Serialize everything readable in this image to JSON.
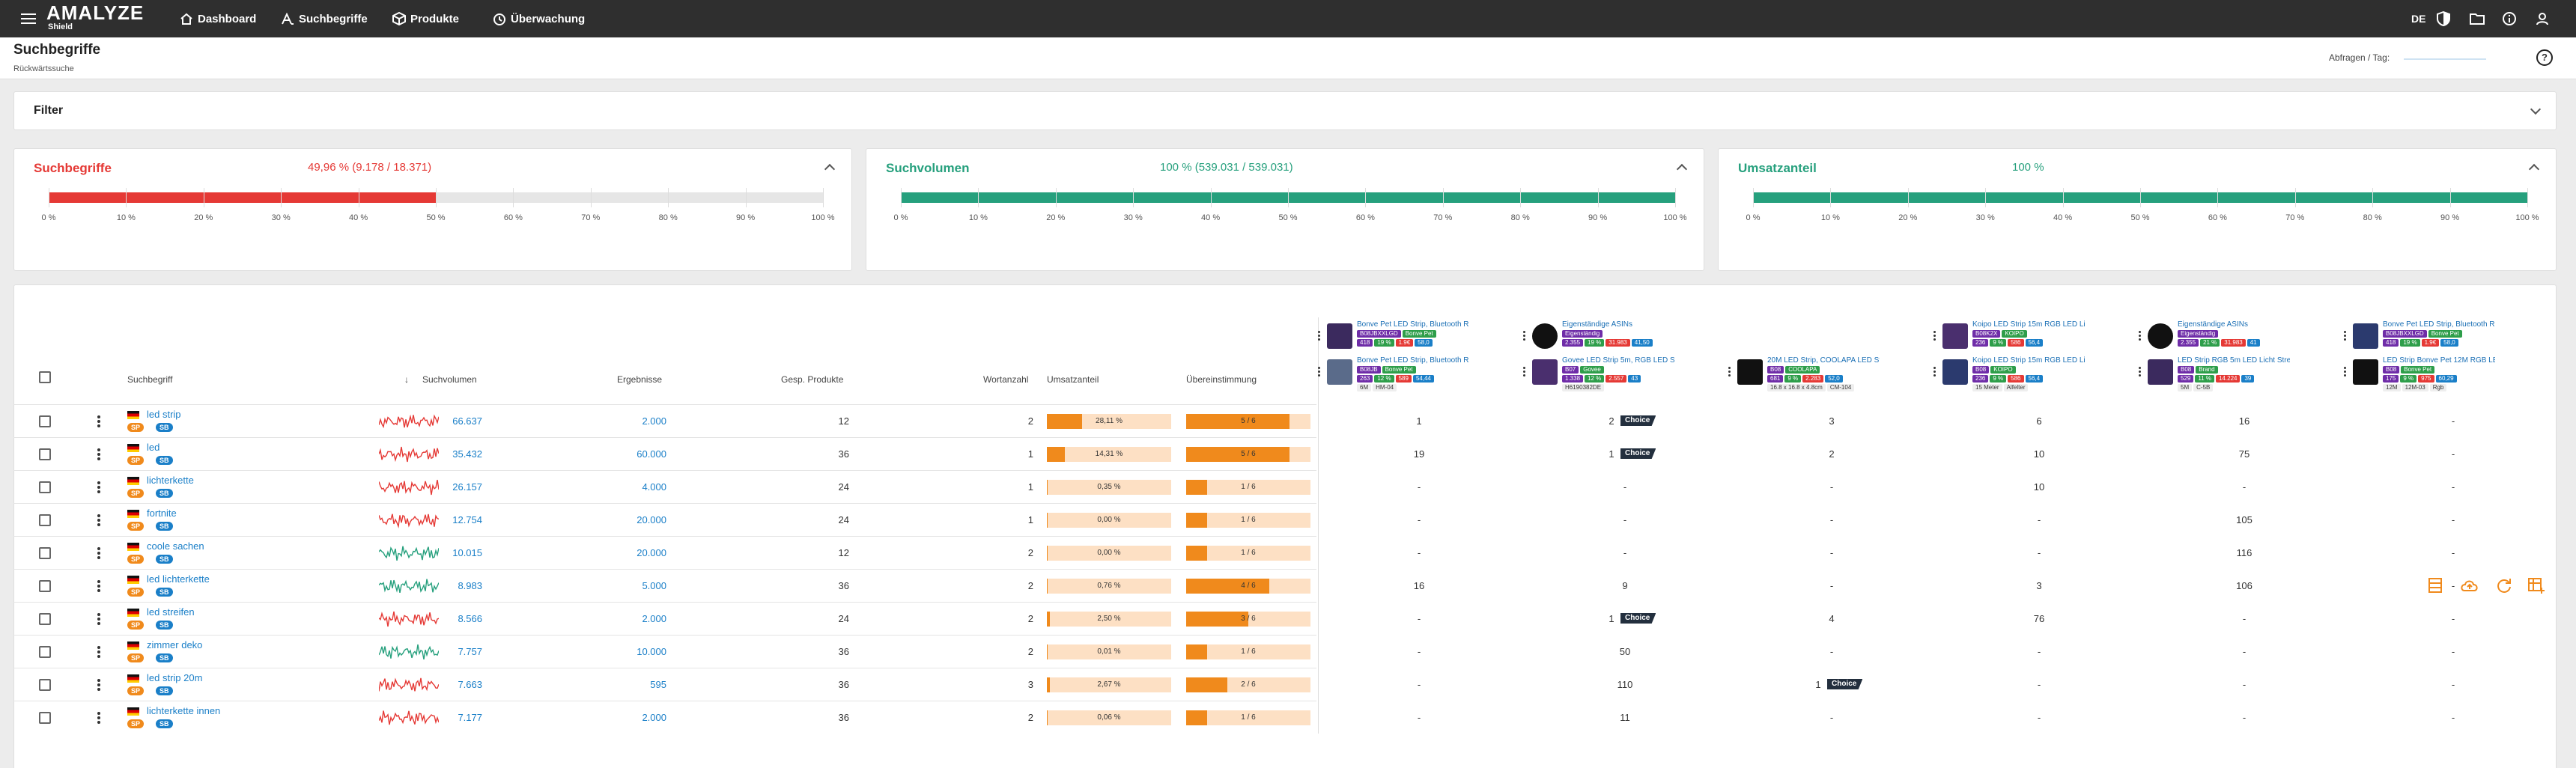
{
  "app": {
    "logo": "AMALYZE",
    "logo_sub": "Shield"
  },
  "nav": {
    "items": [
      "Dashboard",
      "Suchbegriffe",
      "Produkte",
      "Überwachung"
    ],
    "lang": "DE"
  },
  "page": {
    "title": "Suchbegriffe",
    "subtitle": "Rückwärtssuche",
    "quota_label": "Abfragen / Tag:"
  },
  "filter": {
    "label": "Filter"
  },
  "kpis": [
    {
      "title": "Suchbegriffe",
      "value": "49,96 % (9.178 / 18.371)",
      "fill": 0.4996,
      "color": "#e53935"
    },
    {
      "title": "Suchvolumen",
      "value": "100 % (539.031 / 539.031)",
      "fill": 1.0,
      "color": "#26a07d"
    },
    {
      "title": "Umsatzanteil",
      "value": "100 %",
      "fill": 1.0,
      "color": "#26a07d"
    }
  ],
  "kpi_ticks": [
    "0 %",
    "10 %",
    "20 %",
    "30 %",
    "40 %",
    "50 %",
    "60 %",
    "70 %",
    "80 %",
    "90 %",
    "100 %"
  ],
  "columns": {
    "keyword": "Suchbegriff",
    "volume": "Suchvolumen",
    "results": "Ergebnisse",
    "products": "Gesp. Produkte",
    "words": "Wortanzahl",
    "share": "Umsatzanteil",
    "match": "Übereinstimmung"
  },
  "products_top": [
    {
      "title": "Bonve Pet LED Strip, Bluetooth RGB L",
      "pills": [
        "B08JBXXLGD",
        "Bonve Pet"
      ],
      "pills2": [
        "418",
        "19 %",
        "1.9€",
        "58,0"
      ]
    },
    {
      "title": "Eigenständige ASINs",
      "pills": [
        "Eigenständig"
      ],
      "pills2": [
        "2.355",
        "19 %",
        "31.983",
        "41,50"
      ]
    },
    {
      "title": "",
      "pills": [],
      "pills2": []
    },
    {
      "title": "Koipo LED Strip 15m RGB LED Lichte",
      "pills": [
        "B08K2X",
        "KOIPO"
      ],
      "pills2": [
        "236",
        "9 %",
        "586",
        "56,4"
      ]
    },
    {
      "title": "Eigenständige ASINs",
      "pills": [
        "Eigenständig"
      ],
      "pills2": [
        "2.355",
        "21 %",
        "31.983",
        "41"
      ]
    },
    {
      "title": "Bonve Pet LED Strip, Bluetooth RGB L",
      "pills": [
        "B08JBXXLGD",
        "Bonve Pet"
      ],
      "pills2": [
        "418",
        "19 %",
        "1.9€",
        "58,0"
      ]
    }
  ],
  "products_bottom": [
    {
      "title": "Bonve Pet LED Strip, Bluetooth RGB L",
      "pills": [
        "B08JB",
        "Bonve Pet"
      ],
      "pills2": [
        "263",
        "12 %",
        "589",
        "54,44"
      ],
      "tags": [
        "6M",
        "HM-04"
      ]
    },
    {
      "title": "Govee LED Strip 5m, RGB LED Streife",
      "pills": [
        "B07",
        "Govee"
      ],
      "pills2": [
        "1.338",
        "12 %",
        "2.557",
        "43"
      ],
      "tags": [
        "H6190382DE"
      ]
    },
    {
      "title": "20M LED Strip, COOLAPA LED Streife",
      "pills": [
        "B08",
        "COOLAPA"
      ],
      "pills2": [
        "681",
        "9 %",
        "2.283",
        "52,0"
      ],
      "tags": [
        "16.8 x 16.8 x 4.8cm",
        "CM-104"
      ]
    },
    {
      "title": "Koipo LED Strip 15m RGB LED Lichte",
      "pills": [
        "B08",
        "KOIPO"
      ],
      "pills2": [
        "236",
        "9 %",
        "586",
        "56,4"
      ],
      "tags": [
        "15 Meter",
        "Alfelter"
      ]
    },
    {
      "title": "LED Strip RGB 5m LED Licht Streifen",
      "pills": [
        "B08",
        "Brand"
      ],
      "pills2": [
        "529",
        "11 %",
        "14.224",
        "39"
      ],
      "tags": [
        "5M",
        "C-5B"
      ]
    },
    {
      "title": "LED Strip Bonve Pet 12M RGB LED Str",
      "pills": [
        "B08",
        "Bonve Pet"
      ],
      "pills2": [
        "175",
        "9 %",
        "975",
        "60,29"
      ],
      "tags": [
        "12M",
        "12M-03",
        "Rgb"
      ]
    }
  ],
  "rows": [
    {
      "kw": "led strip",
      "vol": "66.637",
      "res": "2.000",
      "prod": "12",
      "words": "2",
      "share": "28,11 %",
      "share_v": 0.2811,
      "match": "5 / 6",
      "match_v": 0.833,
      "color": "#e53935",
      "ranks": [
        "1",
        "2",
        "3",
        "6",
        "16",
        "-"
      ],
      "choice": 1
    },
    {
      "kw": "led",
      "vol": "35.432",
      "res": "60.000",
      "prod": "36",
      "words": "1",
      "share": "14,31 %",
      "share_v": 0.1431,
      "match": "5 / 6",
      "match_v": 0.833,
      "color": "#e53935",
      "ranks": [
        "19",
        "1",
        "2",
        "10",
        "75",
        "-"
      ],
      "choice": 1
    },
    {
      "kw": "lichterkette",
      "vol": "26.157",
      "res": "4.000",
      "prod": "24",
      "words": "1",
      "share": "0,35 %",
      "share_v": 0.0035,
      "match": "1 / 6",
      "match_v": 0.167,
      "color": "#e53935",
      "ranks": [
        "-",
        "-",
        "-",
        "10",
        "-",
        "-"
      ],
      "choice": -1
    },
    {
      "kw": "fortnite",
      "vol": "12.754",
      "res": "20.000",
      "prod": "24",
      "words": "1",
      "share": "0,00 %",
      "share_v": 0.0,
      "match": "1 / 6",
      "match_v": 0.167,
      "color": "#e53935",
      "ranks": [
        "-",
        "-",
        "-",
        "-",
        "105",
        "-"
      ],
      "choice": -1
    },
    {
      "kw": "coole sachen",
      "vol": "10.015",
      "res": "20.000",
      "prod": "12",
      "words": "2",
      "share": "0,00 %",
      "share_v": 0.0,
      "match": "1 / 6",
      "match_v": 0.167,
      "color": "#26a07d",
      "ranks": [
        "-",
        "-",
        "-",
        "-",
        "116",
        "-"
      ],
      "choice": -1
    },
    {
      "kw": "led lichterkette",
      "vol": "8.983",
      "res": "5.000",
      "prod": "36",
      "words": "2",
      "share": "0,76 %",
      "share_v": 0.0076,
      "match": "4 / 6",
      "match_v": 0.667,
      "color": "#26a07d",
      "ranks": [
        "16",
        "9",
        "-",
        "3",
        "106",
        "-"
      ],
      "choice": -1
    },
    {
      "kw": "led streifen",
      "vol": "8.566",
      "res": "2.000",
      "prod": "24",
      "words": "2",
      "share": "2,50 %",
      "share_v": 0.025,
      "match": "3 / 6",
      "match_v": 0.5,
      "color": "#e53935",
      "ranks": [
        "-",
        "1",
        "4",
        "76",
        "-",
        "-"
      ],
      "choice": 1
    },
    {
      "kw": "zimmer deko",
      "vol": "7.757",
      "res": "10.000",
      "prod": "36",
      "words": "2",
      "share": "0,01 %",
      "share_v": 0.0001,
      "match": "1 / 6",
      "match_v": 0.167,
      "color": "#26a07d",
      "ranks": [
        "-",
        "50",
        "-",
        "-",
        "-",
        "-"
      ],
      "choice": -1
    },
    {
      "kw": "led strip 20m",
      "vol": "7.663",
      "res": "595",
      "prod": "36",
      "words": "3",
      "share": "2,67 %",
      "share_v": 0.0267,
      "match": "2 / 6",
      "match_v": 0.333,
      "color": "#e53935",
      "ranks": [
        "-",
        "110",
        "1",
        "-",
        "-",
        "-"
      ],
      "choice": 2
    },
    {
      "kw": "lichterkette innen",
      "vol": "7.177",
      "res": "2.000",
      "prod": "36",
      "words": "2",
      "share": "0,06 %",
      "share_v": 0.0006,
      "match": "1 / 6",
      "match_v": 0.167,
      "color": "#e53935",
      "ranks": [
        "-",
        "11",
        "-",
        "-",
        "-",
        "-"
      ],
      "choice": -1
    }
  ],
  "badges": {
    "sp": "SP",
    "sb": "SB"
  },
  "choice_label": "Choice"
}
